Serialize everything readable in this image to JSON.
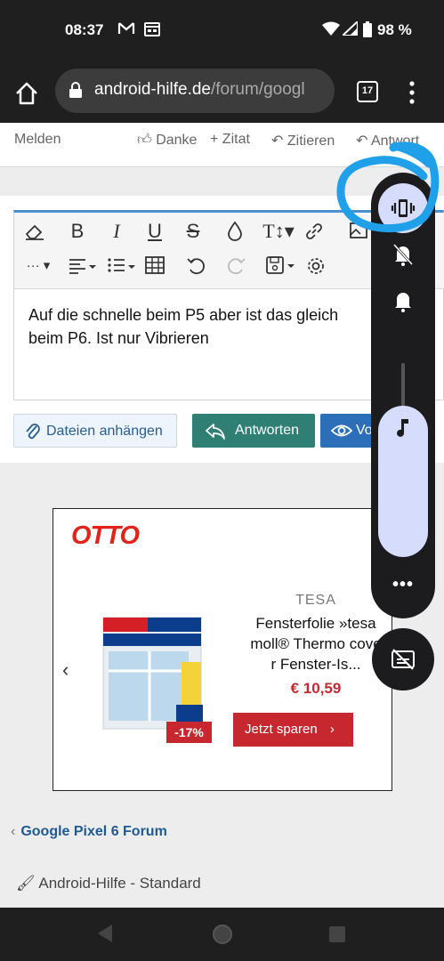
{
  "status": {
    "time": "08:37",
    "battery": "98 %"
  },
  "browser": {
    "url_domain": "android-hilfe.de",
    "url_path": "/forum/googl",
    "tab_count": "17"
  },
  "post_actions": {
    "report": "Melden",
    "thanks": "Danke",
    "quote": "Zitat",
    "cite": "Zitieren",
    "answer": "Antwort"
  },
  "editor": {
    "text_line1": "Auf die schnelle beim P5 aber ist das gleich",
    "text_line2": "beim P6. Ist nur Vibrieren"
  },
  "buttons": {
    "attach": "Dateien anhängen",
    "reply": "Antworten",
    "preview": "Vo"
  },
  "ad": {
    "logo": "OTTO",
    "brand": "TESA",
    "product_line1": "Fensterfolie »tesa",
    "product_line2": "moll® Thermo cove",
    "product_line3": "r Fenster-Is...",
    "price": "€ 10,59",
    "cta": "Jetzt sparen",
    "discount": "-17%"
  },
  "footer": {
    "breadcrumb": "Google Pixel 6 Forum",
    "style_chooser": "Android-Hilfe - Standard"
  },
  "colors": {
    "accent_teal": "#2f7f74",
    "link_blue": "#1f5a96",
    "sale_red": "#c7282f",
    "annotation_blue": "#1fa0e8",
    "volume_accent": "#d6dcfb"
  },
  "volume": {
    "mode": "vibrate-icon",
    "stream": "music-note-icon"
  }
}
